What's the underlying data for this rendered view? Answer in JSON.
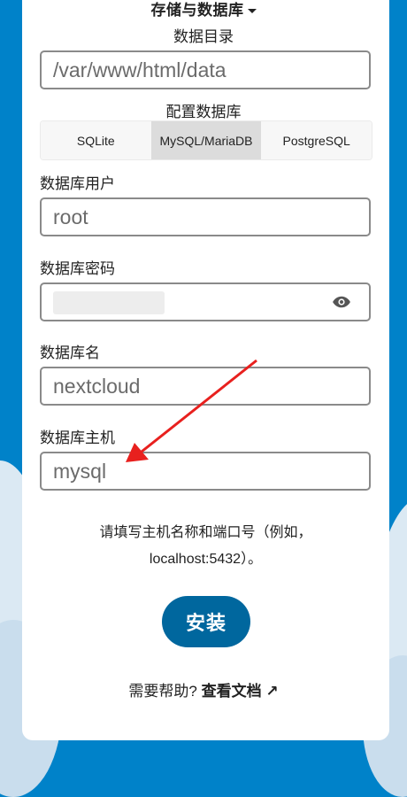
{
  "storage": {
    "heading": "存储与数据库",
    "data_dir_label": "数据目录",
    "data_dir_value": "/var/www/html/data"
  },
  "db_config": {
    "label": "配置数据库",
    "tabs": [
      "SQLite",
      "MySQL/MariaDB",
      "PostgreSQL"
    ],
    "active_tab": "MySQL/MariaDB"
  },
  "fields": {
    "user_label": "数据库用户",
    "user_value": "root",
    "password_label": "数据库密码",
    "name_label": "数据库名",
    "name_value": "nextcloud",
    "host_label": "数据库主机",
    "host_value": "mysql"
  },
  "host_hint": {
    "line1": "请填写主机名称和端口号（例如，",
    "line2": "localhost:5432）。"
  },
  "install_button": "安装",
  "help": {
    "prefix": "需要帮助?",
    "link": "查看文档 ↗"
  },
  "icons": {
    "password_toggle": "eye-icon",
    "heading_toggle": "caret-down-icon"
  },
  "colors": {
    "background": "#0082c9",
    "primary_button": "#00679e",
    "annotation_arrow": "#e8201e"
  }
}
